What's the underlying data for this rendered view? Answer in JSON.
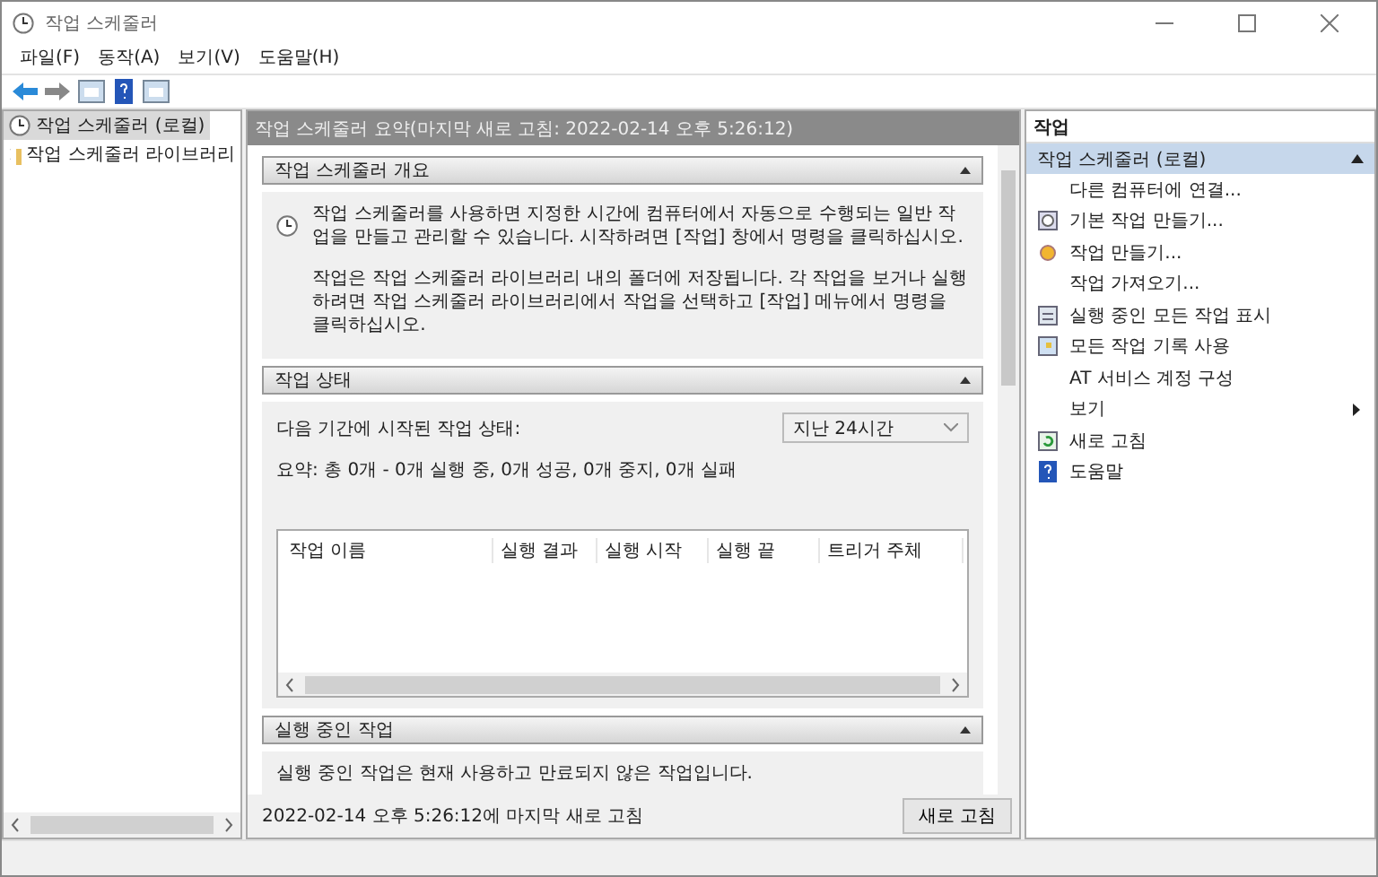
{
  "window": {
    "title": "작업 스케줄러"
  },
  "menu": [
    "파일(F)",
    "동작(A)",
    "보기(V)",
    "도움말(H)"
  ],
  "tree": [
    {
      "label": "작업 스케줄러 (로컬)",
      "selected": true
    },
    {
      "label": "작업 스케줄러 라이브러리",
      "selected": false
    }
  ],
  "summary_header": "작업 스케줄러 요약(마지막 새로 고침: 2022-02-14 오후 5:26:12)",
  "sections": [
    {
      "kind": "overview",
      "title": "작업 스케줄러 개요",
      "expanded": true,
      "paragraphs": [
        "작업 스케줄러를 사용하면 지정한 시간에 컴퓨터에서 자동으로 수행되는 일반 작업을 만들고 관리할 수 있습니다. 시작하려면 [작업] 창에서 명령을 클릭하십시오.",
        "작업은 작업 스케줄러 라이브러리 내의 폴더에 저장됩니다. 각 작업을 보거나 실행하려면 작업 스케줄러 라이브러리에서 작업을 선택하고 [작업] 메뉴에서 명령을 클릭하십시오."
      ]
    },
    {
      "kind": "status",
      "title": "작업 상태",
      "expanded": true,
      "label": "다음 기간에 시작된 작업 상태:",
      "period": "지난 24시간",
      "summary": "요약: 총 0개 - 0개 실행 중, 0개 성공, 0개 중지, 0개 실패",
      "columns": [
        "작업 이름",
        "실행 결과",
        "실행 시작",
        "실행 끝",
        "트리거 주체"
      ]
    },
    {
      "kind": "running",
      "title": "실행 중인 작업",
      "expanded": true,
      "text": "실행 중인 작업은 현재 사용하고 만료되지 않은 작업입니다."
    }
  ],
  "footer": {
    "text": "2022-02-14 오후 5:26:12에 마지막 새로 고침",
    "button": "새로 고침"
  },
  "actions": {
    "title": "작업",
    "group": "작업 스케줄러 (로컬)",
    "expanded": true,
    "items": [
      {
        "label": "다른 컴퓨터에 연결...",
        "kind": "plain"
      },
      {
        "label": "기본 작업 만들기...",
        "kind": "icon"
      },
      {
        "label": "작업 만들기...",
        "kind": "icon"
      },
      {
        "label": "작업 가져오기...",
        "kind": "plain"
      },
      {
        "label": "실행 중인 모든 작업 표시",
        "kind": "icon"
      },
      {
        "label": "모든 작업 기록 사용",
        "kind": "icon"
      },
      {
        "label": "AT 서비스 계정 구성",
        "kind": "plain"
      },
      {
        "label": "보기",
        "kind": "submenu"
      },
      {
        "label": "새로 고침",
        "kind": "icon"
      },
      {
        "label": "도움말",
        "kind": "icon"
      }
    ]
  }
}
